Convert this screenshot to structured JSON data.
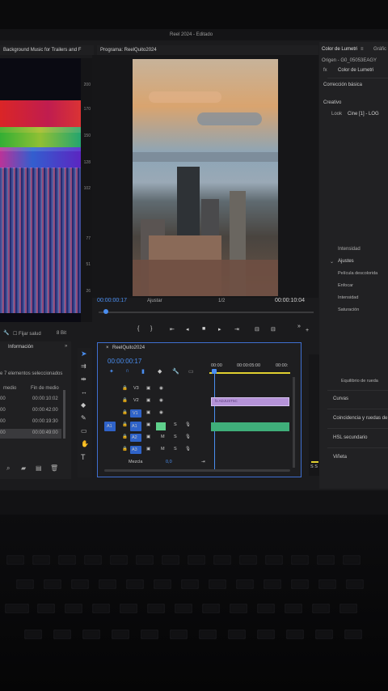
{
  "window": {
    "title": "Reel 2024 - Editado"
  },
  "source_panel": {
    "title": "Background Music for Trailers and F"
  },
  "scope_scale": [
    "200",
    "170",
    "150",
    "128",
    "102",
    "77",
    "51",
    "26"
  ],
  "scope_controls": {
    "fijar_label": "Fijar salud",
    "bit_label": "8 Bit"
  },
  "program": {
    "title": "Programa: ReelQuito2024",
    "timecode_left": "00:00:00:17",
    "fit_label": "Ajustar",
    "ratio_label": "1/2",
    "timecode_right": "00:00:10:04"
  },
  "info_panel": {
    "title": "Información",
    "selection": "e 7 elementos seleccionados",
    "col1": "medio",
    "col2": "Fin de medio",
    "rows": [
      [
        "00",
        "00:00:10:02"
      ],
      [
        "00",
        "00:00:42:00"
      ],
      [
        "00",
        "00:00:19:30"
      ],
      [
        "00",
        "00:00:49:00"
      ]
    ]
  },
  "timeline": {
    "sequence_name": "ReelQuito2024",
    "timecode": "00:00:00:17",
    "ruler": [
      "00:00",
      "00:00:05:00",
      "00:00:"
    ],
    "video_tracks": [
      "V3",
      "V2",
      "V1"
    ],
    "audio_tracks": [
      "A1",
      "A2",
      "A3"
    ],
    "source_patch": [
      "V1",
      "A1"
    ],
    "clip_name": "fx ADJUST5C",
    "mix_label": "Mezcla",
    "mix_value": "0,0"
  },
  "lumetri": {
    "tab1": "Color de Lumetri",
    "tab2": "Gráfic",
    "source": "Origen - G0_05053EAGY",
    "fx_label": "Color de Lumetri",
    "section_basic": "Corrección básica",
    "creative": "Creativo",
    "look_label": "Look",
    "look_value": "Cine [1] - LOG",
    "intensity": "Intensidad",
    "settings_label": "Ajustes",
    "settings": [
      "Película descolorida",
      "Enfocar",
      "Intensidad",
      "Saturación"
    ],
    "wheel_label": "Equilibrio de rueda",
    "sections": [
      "Curvas",
      "Coincidencia y ruedas de",
      "HSL secundario",
      "Viñeta"
    ]
  },
  "audio_meter_label": "S  S",
  "colors": {
    "accent": "#2f63c9",
    "timecode": "#4a8ef0",
    "clip_video": "#b593d8",
    "clip_audio": "#3fae7a"
  }
}
